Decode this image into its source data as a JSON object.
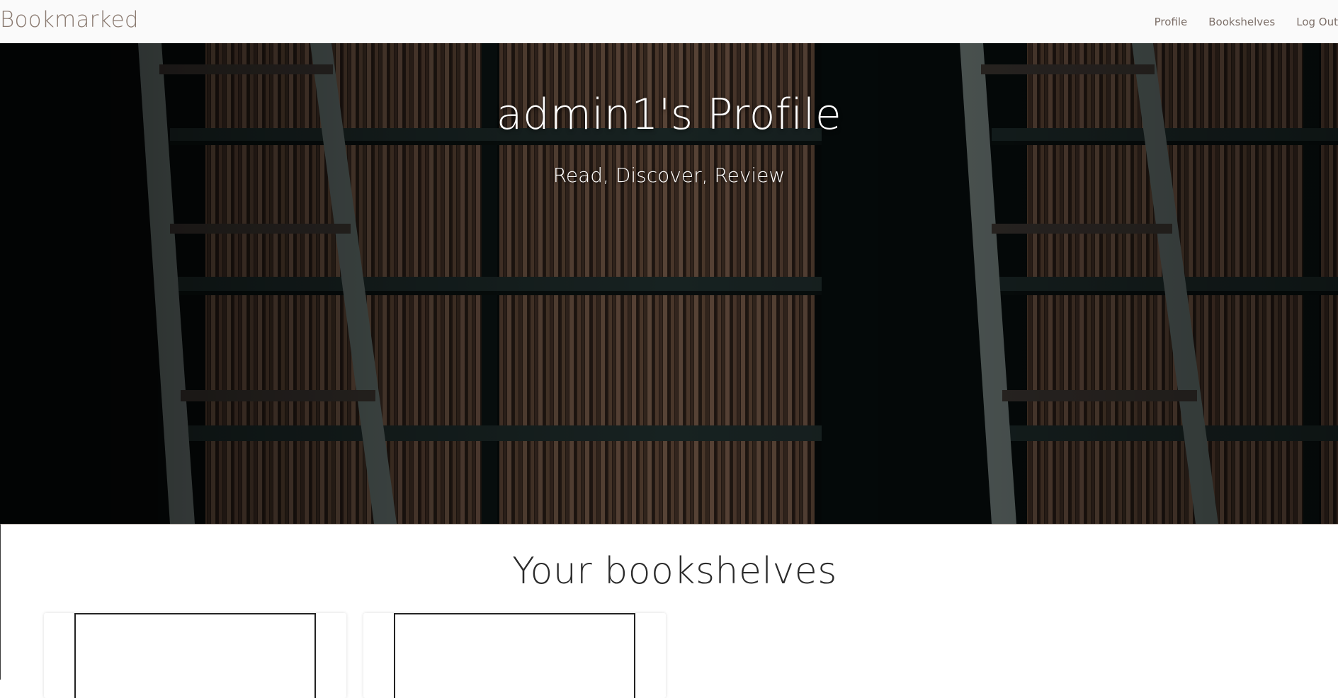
{
  "navbar": {
    "brand": "Bookmarked",
    "links": [
      {
        "label": "Profile"
      },
      {
        "label": "Bookshelves"
      },
      {
        "label": "Log Out"
      }
    ]
  },
  "hero": {
    "title": "admin1's Profile",
    "subtitle": "Read, Discover, Review"
  },
  "bookshelves": {
    "heading": "Your bookshelves",
    "cards": [
      {
        "name": ""
      },
      {
        "name": ""
      }
    ]
  },
  "colors": {
    "brand": "#8a7a70",
    "nav_link": "#7d7069",
    "nav_background": "#fafafa",
    "hero_dark": "#0c1312"
  }
}
